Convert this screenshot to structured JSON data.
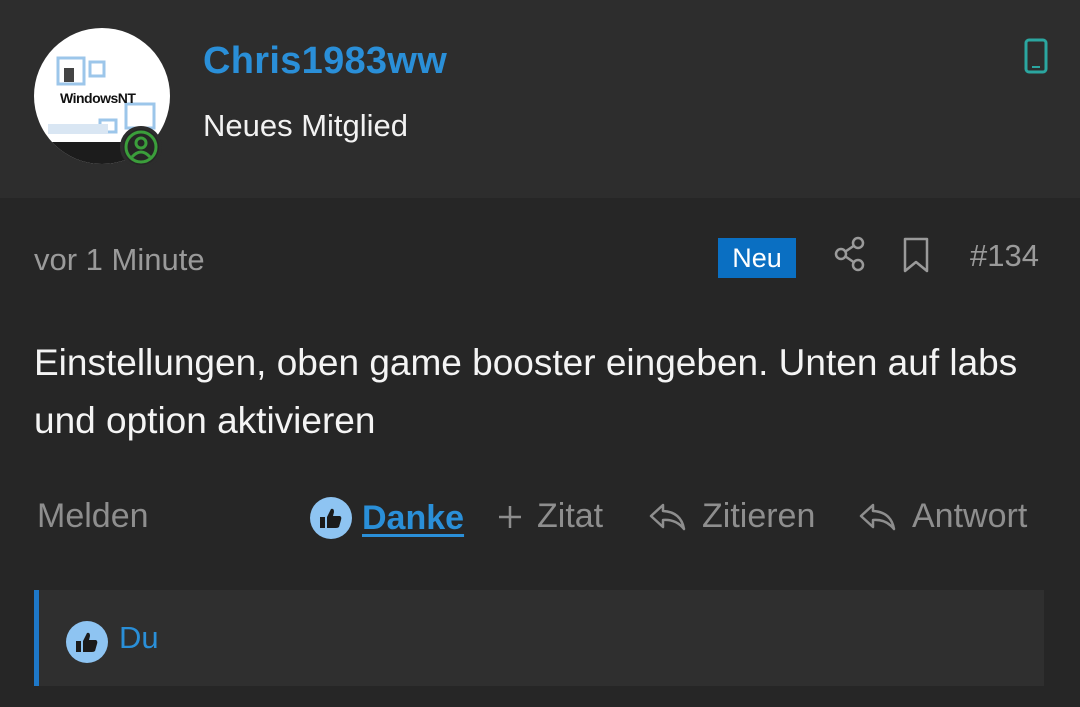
{
  "author": {
    "username": "Chris1983ww",
    "title": "Neues Mitglied",
    "avatar_text": "WindowsNT",
    "status_icon": "user-online-icon",
    "device_icon": "mobile-device-icon",
    "accent_color": "#2a8fd8"
  },
  "post": {
    "time": "vor 1 Minute",
    "badge": "Neu",
    "number": "#134",
    "body": "Einstellungen, oben game booster eingeben. Unten auf labs und option aktivieren"
  },
  "actions": {
    "report": "Melden",
    "like": "Danke",
    "quote_add": "Zitat",
    "quote": "Zitieren",
    "reply": "Antwort"
  },
  "reactions": {
    "users": "Du"
  },
  "colors": {
    "background": "#262626",
    "header_background": "#2d2d2d",
    "badge": "#0a6fc2",
    "muted_text": "#9a9a9a"
  }
}
